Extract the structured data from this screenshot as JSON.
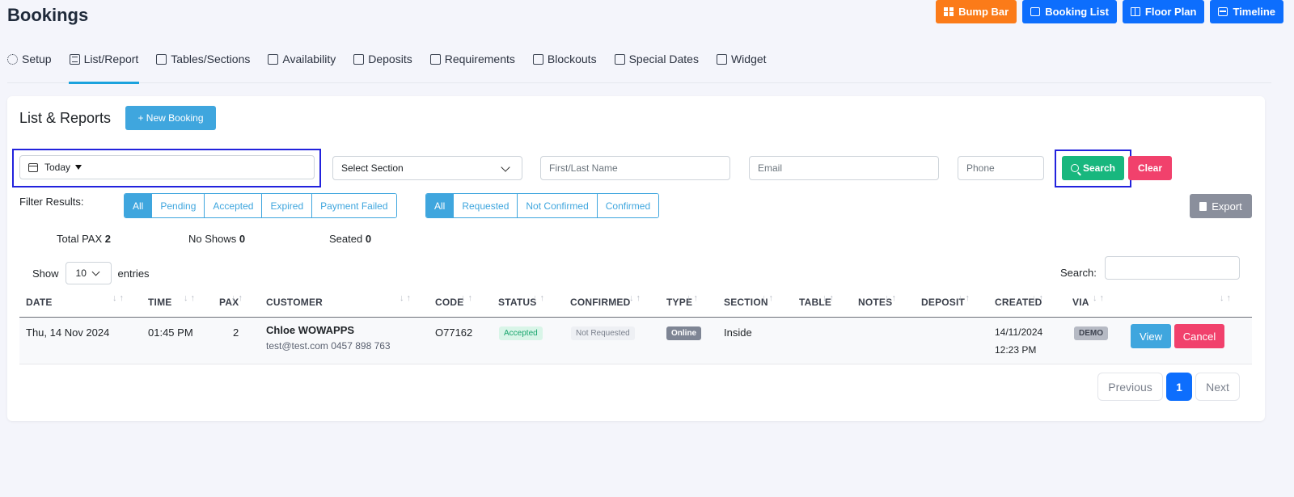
{
  "page": {
    "title": "Bookings"
  },
  "top_buttons": [
    {
      "label": "Bump Bar",
      "icon": "grid-icon",
      "color": "#fb7b19"
    },
    {
      "label": "Booking List",
      "icon": "list-box-icon",
      "color": "#0d6efd"
    },
    {
      "label": "Floor Plan",
      "icon": "floor-plan-icon",
      "color": "#0d6efd"
    },
    {
      "label": "Timeline",
      "icon": "timeline-icon",
      "color": "#0d6efd"
    }
  ],
  "tabs": [
    {
      "label": "Setup",
      "icon": "gear-icon"
    },
    {
      "label": "List/Report",
      "icon": "list-icon",
      "active": true
    },
    {
      "label": "Tables/Sections",
      "icon": "table-icon"
    },
    {
      "label": "Availability",
      "icon": "clipboard-icon"
    },
    {
      "label": "Deposits",
      "icon": "coins-icon"
    },
    {
      "label": "Requirements",
      "icon": "card-icon"
    },
    {
      "label": "Blockouts",
      "icon": "calendar-x-icon"
    },
    {
      "label": "Special Dates",
      "icon": "calendar-star-icon"
    },
    {
      "label": "Widget",
      "icon": "external-link-icon"
    }
  ],
  "card": {
    "title": "List & Reports",
    "new_booking": "+ New Booking"
  },
  "filters": {
    "date_value": "Today",
    "section_value": "Select Section",
    "name_placeholder": "First/Last Name",
    "email_placeholder": "Email",
    "phone_placeholder": "Phone",
    "search_label": "Search",
    "clear_label": "Clear"
  },
  "filter_results": {
    "label": "Filter Results:",
    "status_group": [
      "All",
      "Pending",
      "Accepted",
      "Expired",
      "Payment Failed"
    ],
    "confirm_group": [
      "All",
      "Requested",
      "Not Confirmed",
      "Confirmed"
    ],
    "export_label": "Export"
  },
  "stats": {
    "total_pax_label": "Total PAX",
    "total_pax": "2",
    "no_shows_label": "No Shows",
    "no_shows": "0",
    "seated_label": "Seated",
    "seated": "0"
  },
  "table_controls": {
    "show_label": "Show",
    "entries_value": "10",
    "entries_label": "entries",
    "search_label": "Search:"
  },
  "columns": [
    "DATE",
    "TIME",
    "PAX",
    "CUSTOMER",
    "CODE",
    "STATUS",
    "CONFIRMED",
    "TYPE",
    "SECTION",
    "TABLE",
    "NOTES",
    "DEPOSIT",
    "CREATED",
    "VIA"
  ],
  "rows": [
    {
      "date": "Thu, 14 Nov 2024",
      "time": "01:45 PM",
      "pax": "2",
      "customer_name": "Chloe WOWAPPS",
      "customer_contact": "test@test.com 0457 898 763",
      "code": "O77162",
      "status": "Accepted",
      "confirmed": "Not Requested",
      "type": "Online",
      "section": "Inside",
      "created_date": "14/11/2024",
      "created_time": "12:23 PM",
      "via": "DEMO",
      "view_label": "View",
      "cancel_label": "Cancel"
    }
  ],
  "pagination": {
    "previous": "Previous",
    "current": "1",
    "next": "Next"
  }
}
